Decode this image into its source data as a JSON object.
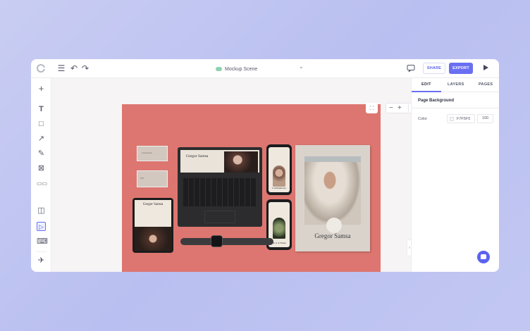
{
  "topbar": {
    "doc_title": "Mockup Scene",
    "share_label": "SHARE",
    "export_label": "EXPORT"
  },
  "canvas": {
    "zoom_label": "45%",
    "page_color": "#dd7670",
    "mockup_texts": {
      "laptop_title": "Gregor Samsa",
      "tablet_title": "Gregor Samsa",
      "phone1_caption": "Communicate",
      "phone2_caption": "Do it at Home",
      "poster_title": "Gregor Samsa"
    }
  },
  "right_panel": {
    "tabs": [
      {
        "label": "EDIT",
        "active": true
      },
      {
        "label": "LAYERS",
        "active": false
      },
      {
        "label": "PAGES",
        "active": false
      }
    ],
    "section_title": "Page Background",
    "color_label": "Color",
    "color_hex": "F7F5F5",
    "opacity": "100"
  },
  "colors": {
    "accent": "#6a6ff2",
    "background": "#F7F5F5"
  },
  "icons": {
    "topbar": [
      "logo-icon",
      "menu-icon",
      "undo-icon",
      "redo-icon",
      "cloud-icon",
      "chevron-down-icon",
      "comment-icon",
      "play-icon"
    ],
    "left_toolbar": [
      "plus-icon",
      "text-icon",
      "rectangle-icon",
      "arrow-icon",
      "pen-icon",
      "image-icon",
      "grid-icon",
      "frame-icon",
      "pointer-icon",
      "keyboard-icon",
      "pin-icon"
    ]
  }
}
